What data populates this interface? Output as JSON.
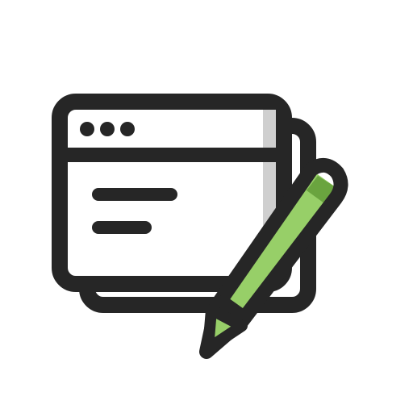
{
  "icon": {
    "name": "browser-window-edit-icon",
    "colors": {
      "outline": "#262626",
      "window_fill": "#ffffff",
      "window_shadow": "#cfcfcf",
      "pencil_body": "#97cf68",
      "pencil_shade": "#6aa43f",
      "background": "#ffffff"
    }
  }
}
